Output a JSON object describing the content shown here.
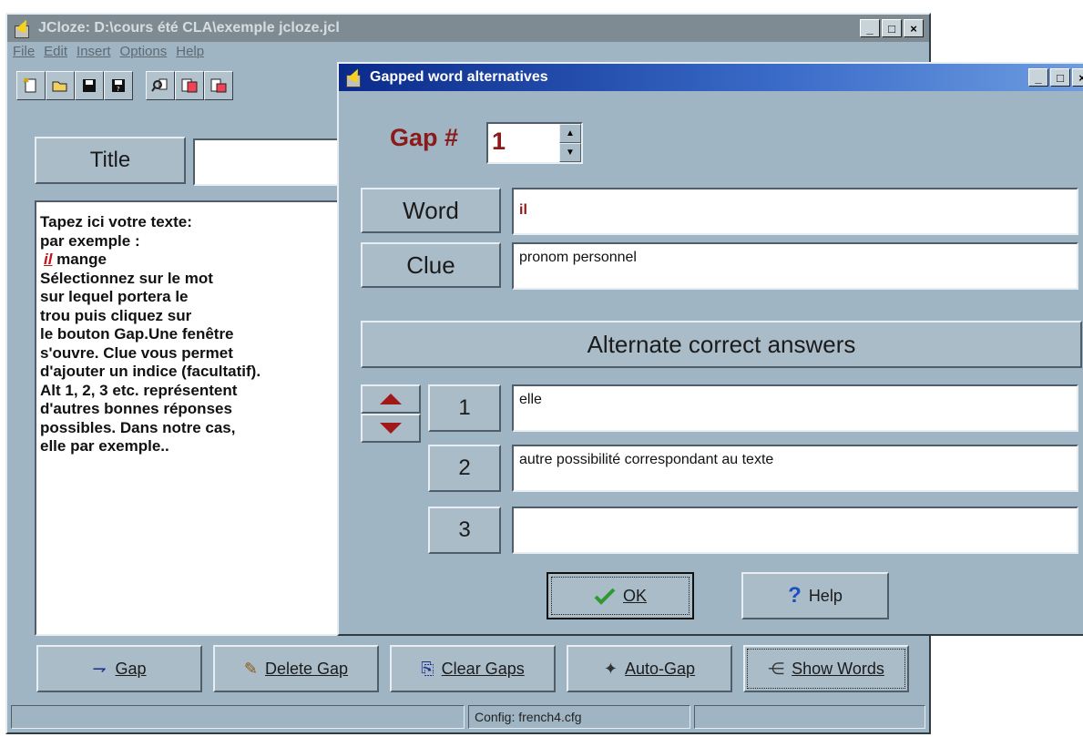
{
  "main_window": {
    "title": "JCloze: D:\\cours été CLA\\exemple jcloze.jcl",
    "menu": [
      "File",
      "Edit",
      "Insert",
      "Options",
      "Help"
    ],
    "title_label": "Title",
    "title_value": "",
    "editor_lines": [
      "Tapez ici votre texte:",
      "par exemple :",
      "",
      "Sélectionnez sur le mot",
      "sur lequel portera le",
      "trou puis cliquez sur",
      "le bouton Gap.Une fenêtre",
      "s'ouvre. Clue vous permet",
      "d'ajouter un indice (facultatif).",
      "Alt 1, 2, 3 etc. représentent",
      "d'autres bonnes réponses",
      "possibles. Dans notre cas,",
      "elle par exemple.."
    ],
    "gapped_word": "il",
    "gapped_line_rest": " mange",
    "buttons": {
      "gap": "Gap",
      "delete_gap": "Delete Gap",
      "clear_gaps": "Clear Gaps",
      "auto_gap": "Auto-Gap",
      "show_words": "Show Words"
    },
    "status": {
      "config": "Config: french4.cfg"
    }
  },
  "dialog": {
    "title": "Gapped word alternatives",
    "gap_label": "Gap #",
    "gap_number": "1",
    "word_label": "Word",
    "word_value": "il",
    "clue_label": "Clue",
    "clue_value": "pronom personnel",
    "alternates_heading": "Alternate correct answers",
    "alternates": [
      {
        "num": "1",
        "value": "elle"
      },
      {
        "num": "2",
        "value": "autre possibilité correspondant au texte"
      },
      {
        "num": "3",
        "value": ""
      }
    ],
    "ok_label": "OK",
    "help_label": "Help"
  },
  "caption_buttons": {
    "minimize": "_",
    "maximize": "□",
    "close": "×"
  },
  "colors": {
    "window_face": "#9fb5c3",
    "active_title": "#0a2a8a",
    "inactive_title": "#7f8b92",
    "label_red": "#8b1a1a",
    "gap_word_red": "#c0161a",
    "ok_check": "#2f9a2f",
    "help_blue": "#1e4fc0"
  },
  "icons": [
    "app-lightning-icon",
    "new-file-icon",
    "open-folder-icon",
    "save-icon",
    "save-as-icon",
    "find-icon",
    "export-icon",
    "import-icon",
    "arrow-up-icon",
    "arrow-down-icon",
    "checkmark-icon",
    "question-icon",
    "gap-icon",
    "eraser-icon",
    "clear-icon",
    "wand-icon",
    "tree-icon"
  ]
}
